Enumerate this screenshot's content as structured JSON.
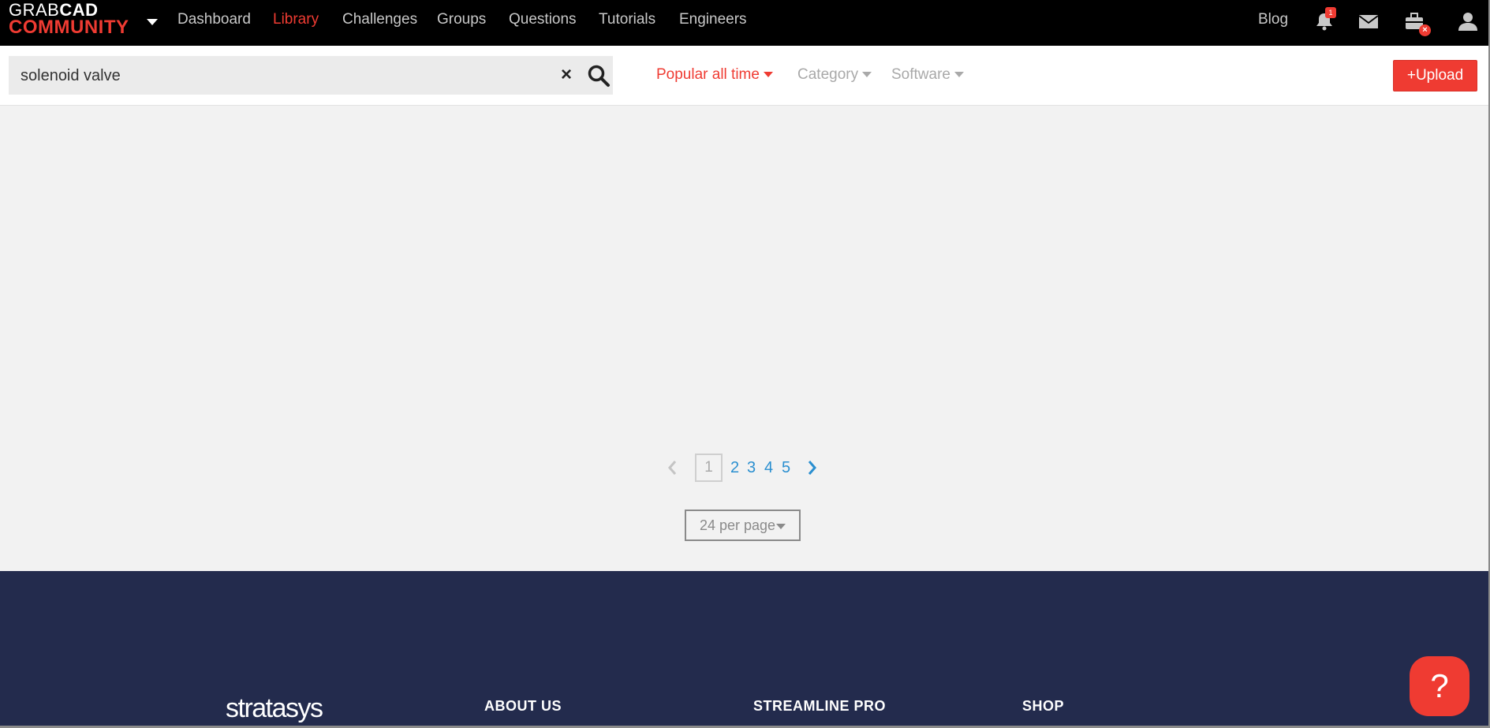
{
  "brand": {
    "line1_light": "GRAB",
    "line1_bold": "CAD",
    "line2": "COMMUNITY"
  },
  "nav": {
    "items": [
      {
        "label": "Dashboard"
      },
      {
        "label": "Library"
      },
      {
        "label": "Challenges"
      },
      {
        "label": "Groups"
      },
      {
        "label": "Questions"
      },
      {
        "label": "Tutorials"
      },
      {
        "label": "Engineers"
      }
    ],
    "active": "Library",
    "blog": "Blog",
    "notification_count": "1",
    "icons": [
      "bell-icon",
      "mail-icon",
      "toolbox-icon",
      "user-icon"
    ]
  },
  "search": {
    "value": "solenoid valve",
    "clear_glyph": "×"
  },
  "filters": {
    "sort": "Popular all time",
    "category": "Category",
    "software": "Software"
  },
  "upload_label": "+Upload",
  "pagination": {
    "current": "1",
    "pages": [
      "2",
      "3",
      "4",
      "5"
    ],
    "per_page": "24 per page"
  },
  "footer": {
    "logo": "stratasys",
    "headings": [
      "ABOUT US",
      "STREAMLINE PRO",
      "SHOP"
    ],
    "help": "?"
  },
  "colors": {
    "accent": "#ef3b32",
    "link": "#2a8fd0",
    "footer_bg": "#232b4d"
  }
}
